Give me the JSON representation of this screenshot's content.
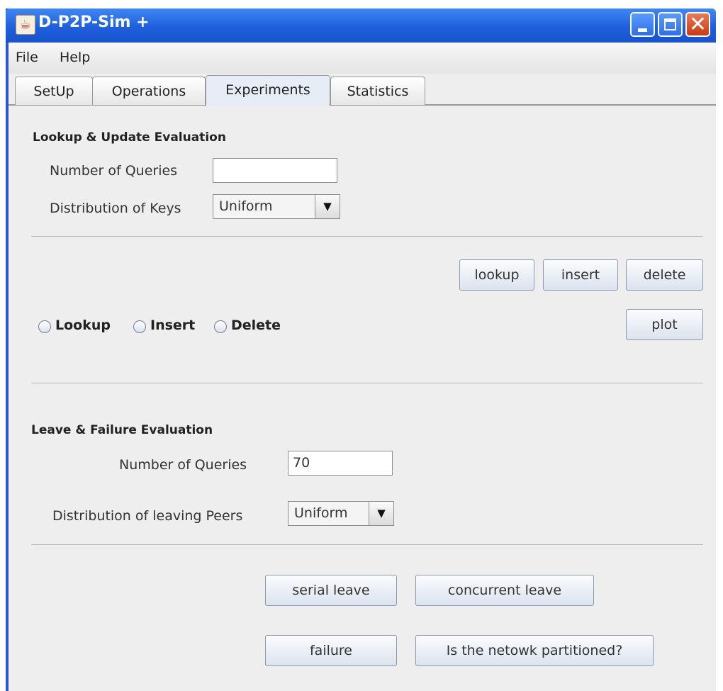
{
  "window": {
    "title": "D-P2P-Sim +",
    "icon": "java-cup-icon"
  },
  "menu": [
    "File",
    "Help"
  ],
  "tabs": [
    "SetUp",
    "Operations",
    "Experiments",
    "Statistics"
  ],
  "active_tab": "Experiments",
  "lookup_section": {
    "header": "Lookup & Update Evaluation",
    "queries_label": "Number of Queries",
    "queries_value": "",
    "keys_label": "Distribution of Keys",
    "keys_value": "Uniform",
    "buttons": {
      "lookup": "lookup",
      "insert": "insert",
      "delete": "delete",
      "plot": "plot"
    },
    "radios": [
      "Lookup",
      "Insert",
      "Delete"
    ]
  },
  "leave_section": {
    "header": "Leave & Failure Evaluation",
    "queries_label": "Number of Queries",
    "queries_value": "70",
    "peers_label": "Distribution of leaving Peers",
    "peers_value": "Uniform",
    "buttons": {
      "serial_leave": "serial leave",
      "concurrent_leave": "concurrent leave",
      "failure": "failure",
      "partitioned": "Is the netowk partitioned?"
    }
  },
  "colors": {
    "titlebar": "#1f5fdc",
    "close": "#c93b15",
    "panel": "#eeeeee"
  }
}
